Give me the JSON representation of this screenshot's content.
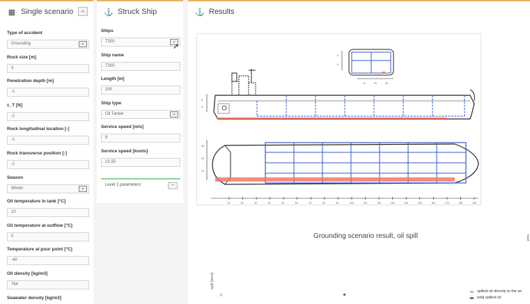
{
  "left_panel": {
    "title": "Single scenario",
    "title_icon": "table-icon",
    "collapse_label": "−",
    "fields": [
      {
        "label": "Type of accident",
        "value": "Grounding",
        "kind": "select"
      },
      {
        "label": "Rock size [m]",
        "value": "3",
        "kind": "input"
      },
      {
        "label": "Penetration depth [m]",
        "value": "-1",
        "kind": "input"
      },
      {
        "label": "c_T [N]",
        "value": "-1",
        "kind": "input"
      },
      {
        "label": "Rock longitudinal location [-]",
        "value": "-1",
        "kind": "input"
      },
      {
        "label": "Rock transverse position [-]",
        "value": "-1",
        "kind": "input"
      },
      {
        "label": "Season",
        "value": "Winter",
        "kind": "select"
      },
      {
        "label": "Oil temperature in tank [°C]",
        "value": "10",
        "kind": "input"
      },
      {
        "label": "Oil temperature at outflow [°C]",
        "value": "0",
        "kind": "input"
      },
      {
        "label": "Temperature at pour point [°C]",
        "value": "-40",
        "kind": "input"
      },
      {
        "label": "Oil density [kg/m3]",
        "value": "764",
        "kind": "input"
      },
      {
        "label": "Seawater density [kg/m3]",
        "value": "",
        "kind": "input"
      }
    ]
  },
  "mid_panel": {
    "title": "Struck Ship",
    "title_icon": "anchor-icon",
    "fields": [
      {
        "label": "Ships",
        "value": "T200",
        "kind": "select"
      },
      {
        "label": "Ship name",
        "value": "T200",
        "kind": "input"
      },
      {
        "label": "Length [m]",
        "value": "200",
        "kind": "input"
      },
      {
        "label": "Ship type",
        "value": "Oil Tanker",
        "kind": "select"
      },
      {
        "label": "Service speed [m/s]",
        "value": "8",
        "kind": "input"
      },
      {
        "label": "Service speed [knots]",
        "value": "15.55",
        "kind": "input"
      }
    ],
    "level2_label": "Level 2 parameters",
    "level2_button": "−"
  },
  "results_panel": {
    "title": "Results",
    "title_icon": "anchor-icon",
    "drawing": {
      "section_ticks_x": [
        "10",
        "20",
        "30"
      ],
      "section_ticks_y": [
        "0",
        "5"
      ],
      "profile_ticks_y": [
        "0",
        "5"
      ],
      "plan_ticks_y": [
        "30",
        "20",
        "10"
      ],
      "length_ticks": [
        "10",
        "20",
        "30",
        "40",
        "50",
        "60",
        "70",
        "80",
        "90",
        "100",
        "110",
        "120",
        "130",
        "140",
        "150",
        "160",
        "170",
        "180",
        "190"
      ]
    },
    "chart_title": "Grounding scenario result, oil spill",
    "edge_glyph": "[",
    "y_axis_label": "spill [tons]",
    "y_zero": "0",
    "legend": [
      {
        "label": "spilled oil directly to the se",
        "color": "#7cb5ec"
      },
      {
        "label": "total spilled oil",
        "color": "#434348"
      }
    ]
  },
  "colors": {
    "accent": "#e8b25a",
    "tank_lines": "#3355cc",
    "damage": "#f07060",
    "level2_bar": "#8fd08f"
  }
}
